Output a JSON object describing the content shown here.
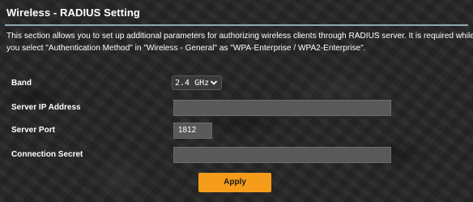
{
  "header": {
    "title": "Wireless - RADIUS Setting"
  },
  "description": {
    "line1": "This section allows you to set up additional parameters for authorizing wireless clients through RADIUS server. It is required while",
    "line2": "you select \"Authentication Method\" in \"Wireless - General\" as \"WPA-Enterprise / WPA2-Enterprise\"."
  },
  "form": {
    "band": {
      "label": "Band",
      "selected": "2.4 GHz"
    },
    "server_ip": {
      "label": "Server IP Address",
      "value": ""
    },
    "server_port": {
      "label": "Server Port",
      "value": "1812"
    },
    "connection_secret": {
      "label": "Connection Secret",
      "value": ""
    }
  },
  "actions": {
    "apply_label": "Apply"
  },
  "colors": {
    "accent": "#f59c1a",
    "divider": "#8fa8ad",
    "field_bg": "#595959"
  },
  "icons": {
    "band_dropdown": "chevron-down-icon"
  }
}
